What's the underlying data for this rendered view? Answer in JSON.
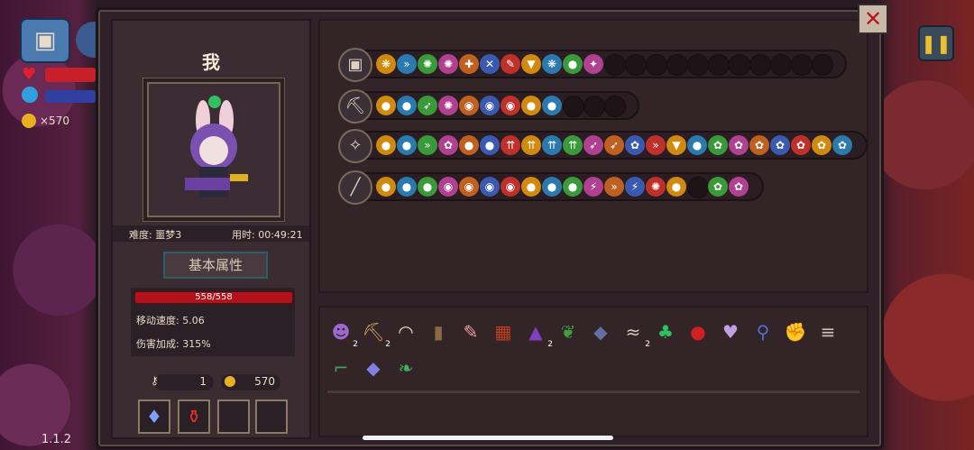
{
  "hud": {
    "coins": "×570",
    "version": "1.1.2"
  },
  "player": {
    "name": "我",
    "difficulty_label": "难度: 噩梦3",
    "time_label": "用时: 00:49:21",
    "attr_button": "基本属性",
    "hp": "558/558",
    "move_speed": "移动速度: 5.06",
    "damage_bonus": "伤害加成: 315%",
    "keys": "1",
    "gold": "570"
  },
  "weapon_rows": [
    {
      "icon": "chest-icon",
      "glyph": "▣",
      "chips": [
        "❋",
        "»",
        "✺",
        "✺",
        "✚",
        "✕",
        "✎",
        "▼",
        "❋",
        "●",
        "✦"
      ],
      "empty": 11
    },
    {
      "icon": "pickaxe-icon",
      "glyph": "⛏",
      "chips": [
        "●",
        "●",
        "➶",
        "✺",
        "◉",
        "◉",
        "◉",
        "●",
        "●"
      ],
      "empty": 3
    },
    {
      "icon": "staff-icon",
      "glyph": "✧",
      "chips": [
        "●",
        "●",
        "»",
        "✿",
        "●",
        "●",
        "⇈",
        "⇈",
        "⇈",
        "⇈",
        "➶",
        "➶",
        "✿",
        "»",
        "▼",
        "●",
        "✿",
        "✿",
        "✿",
        "✿",
        "✿",
        "✿",
        "✿"
      ],
      "empty": 0
    },
    {
      "icon": "spear-icon",
      "glyph": "╱",
      "chips": [
        "●",
        "●",
        "●",
        "◉",
        "◉",
        "◉",
        "◉",
        "●",
        "●",
        "●",
        "⚡",
        "»",
        "⚡",
        "✺",
        "●"
      ],
      "empty": 1,
      "tail": [
        "✿",
        "✿"
      ]
    }
  ],
  "items": [
    {
      "name": "purple-hair-icon",
      "glyph": "☻",
      "count": "2",
      "color": "#9b6ad0"
    },
    {
      "name": "pickaxe-icon",
      "glyph": "⛏",
      "count": "2",
      "color": "#c8a060"
    },
    {
      "name": "teeth-icon",
      "glyph": "◠",
      "count": "",
      "color": "#e8e0c0"
    },
    {
      "name": "lantern-icon",
      "glyph": "▮",
      "count": "",
      "color": "#8a6a40"
    },
    {
      "name": "feather-icon",
      "glyph": "✎",
      "count": "",
      "color": "#f0a0a0"
    },
    {
      "name": "cage-icon",
      "glyph": "▦",
      "count": "",
      "color": "#c04020"
    },
    {
      "name": "witch-hat-icon",
      "glyph": "▲",
      "count": "2",
      "color": "#8040c0"
    },
    {
      "name": "plant-icon",
      "glyph": "❦",
      "count": "",
      "color": "#40a040"
    },
    {
      "name": "stone-icon",
      "glyph": "◆",
      "count": "",
      "color": "#6070a0"
    },
    {
      "name": "bone-icon",
      "glyph": "≈",
      "count": "2",
      "color": "#d0c8b8"
    },
    {
      "name": "clover-icon",
      "glyph": "♣",
      "count": "",
      "color": "#30c060"
    },
    {
      "name": "red-orb-icon",
      "glyph": "●",
      "count": "",
      "color": "#d02020"
    },
    {
      "name": "heart-mask-icon",
      "glyph": "♥",
      "count": "",
      "color": "#c0a0e0"
    },
    {
      "name": "wand-icon",
      "glyph": "⚲",
      "count": "",
      "color": "#5070d0"
    },
    {
      "name": "gauntlet-icon",
      "glyph": "✊",
      "count": "",
      "color": "#d0a020"
    },
    {
      "name": "ribcage-icon",
      "glyph": "≡",
      "count": "",
      "color": "#c8c0b0"
    },
    {
      "name": "boot-icon",
      "glyph": "⌐",
      "count": "",
      "color": "#40a060"
    },
    {
      "name": "crystal-icon",
      "glyph": "◆",
      "count": "",
      "color": "#8080e0"
    },
    {
      "name": "leaf-icon",
      "glyph": "❧",
      "count": "",
      "color": "#40b060"
    }
  ]
}
